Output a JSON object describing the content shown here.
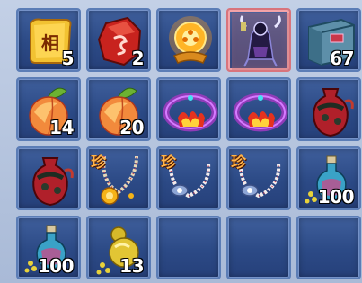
{
  "inventory": {
    "slots": [
      {
        "item_icon": "ticket-scroll-icon",
        "scroll_text": "相",
        "count": "5"
      },
      {
        "item_icon": "red-rune-stone-icon",
        "count": "2"
      },
      {
        "item_icon": "golden-orb-icon"
      },
      {
        "item_icon": "demon-figure-icon",
        "selected": true
      },
      {
        "item_icon": "blue-book-icon",
        "count": "67"
      },
      {
        "item_icon": "peach-icon",
        "count": "14"
      },
      {
        "item_icon": "peach-icon",
        "count": "20"
      },
      {
        "item_icon": "flame-ring-icon"
      },
      {
        "item_icon": "flame-ring-icon"
      },
      {
        "item_icon": "red-vase-icon"
      },
      {
        "item_icon": "red-vase-icon"
      },
      {
        "item_icon": "gold-necklace-icon",
        "badge": "珍"
      },
      {
        "item_icon": "pearl-necklace-icon",
        "badge": "珍"
      },
      {
        "item_icon": "pearl-necklace-icon",
        "badge": "珍"
      },
      {
        "item_icon": "potion-bottle-icon",
        "count": "100"
      },
      {
        "item_icon": "potion-bottle-icon",
        "count": "100"
      },
      {
        "item_icon": "gourd-icon",
        "count": "13"
      },
      {
        "item_icon": "empty-slot"
      },
      {
        "item_icon": "empty-slot"
      },
      {
        "item_icon": "empty-slot"
      }
    ]
  },
  "colors": {
    "slot_fill": "#2c4a86",
    "slot_border": "#5b7db6",
    "selected_border": "#d8747c",
    "count_text": "#ffffff",
    "badge_text": "#ffb44a"
  }
}
